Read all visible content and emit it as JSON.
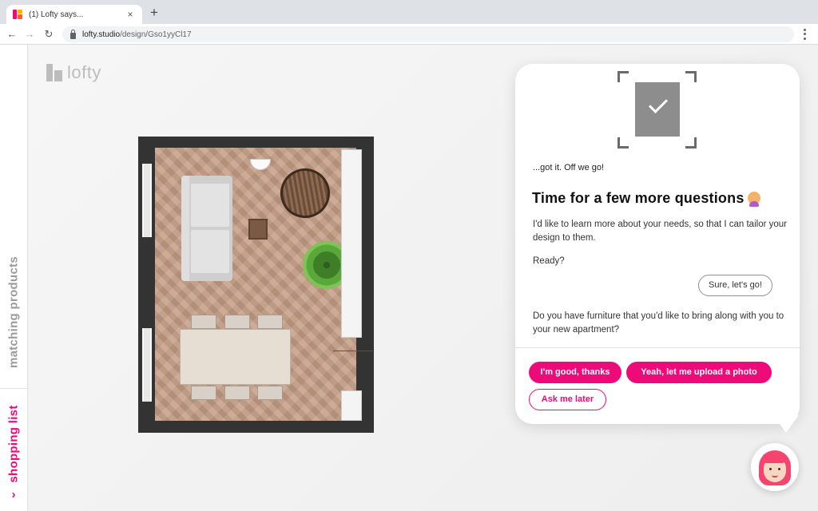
{
  "browser": {
    "tab_title": "(1) Lofty says...",
    "tab_close": "×",
    "new_tab": "+",
    "url_host": "lofty.studio",
    "url_path": "/design/Gso1yyCl17",
    "icons": [
      "favicon-icon",
      "close-icon",
      "plus-icon",
      "back-arrow-icon",
      "forward-arrow-icon",
      "reload-icon",
      "lock-icon",
      "kebab-menu-icon"
    ]
  },
  "sidebar": {
    "matching_products": "matching products",
    "shopping_list": "shopping list",
    "chevron": "›",
    "colors": {
      "active": "#ef0a7a",
      "inactive": "#9b9b9b"
    }
  },
  "app": {
    "logo_text": "lofty"
  },
  "floorplan": {
    "furniture": [
      "sofa",
      "side-table",
      "round-chair",
      "floor-lamp",
      "potted-plant",
      "dining-table",
      "dining-chair"
    ]
  },
  "chat": {
    "status_icon": "checkmark-icon",
    "got_it": "...got it. Off we go!",
    "heading": "Time for a few more questions",
    "heading_emoji": "person-tipping-hand-emoji",
    "body": "I'd like to learn more about your needs, so that I can tailor your design to them.",
    "ready": "Ready?",
    "user_reply": "Sure, let's go!",
    "question": "Do you have furniture that you'd like to bring along with you to your new apartment?",
    "options": [
      {
        "label": "I'm good, thanks"
      },
      {
        "label": "Yeah, let me upload a photo"
      },
      {
        "label": "Ask me later"
      }
    ],
    "accent": "#ef0a7a"
  },
  "assistant": {
    "avatar": "assistant-avatar-icon"
  }
}
